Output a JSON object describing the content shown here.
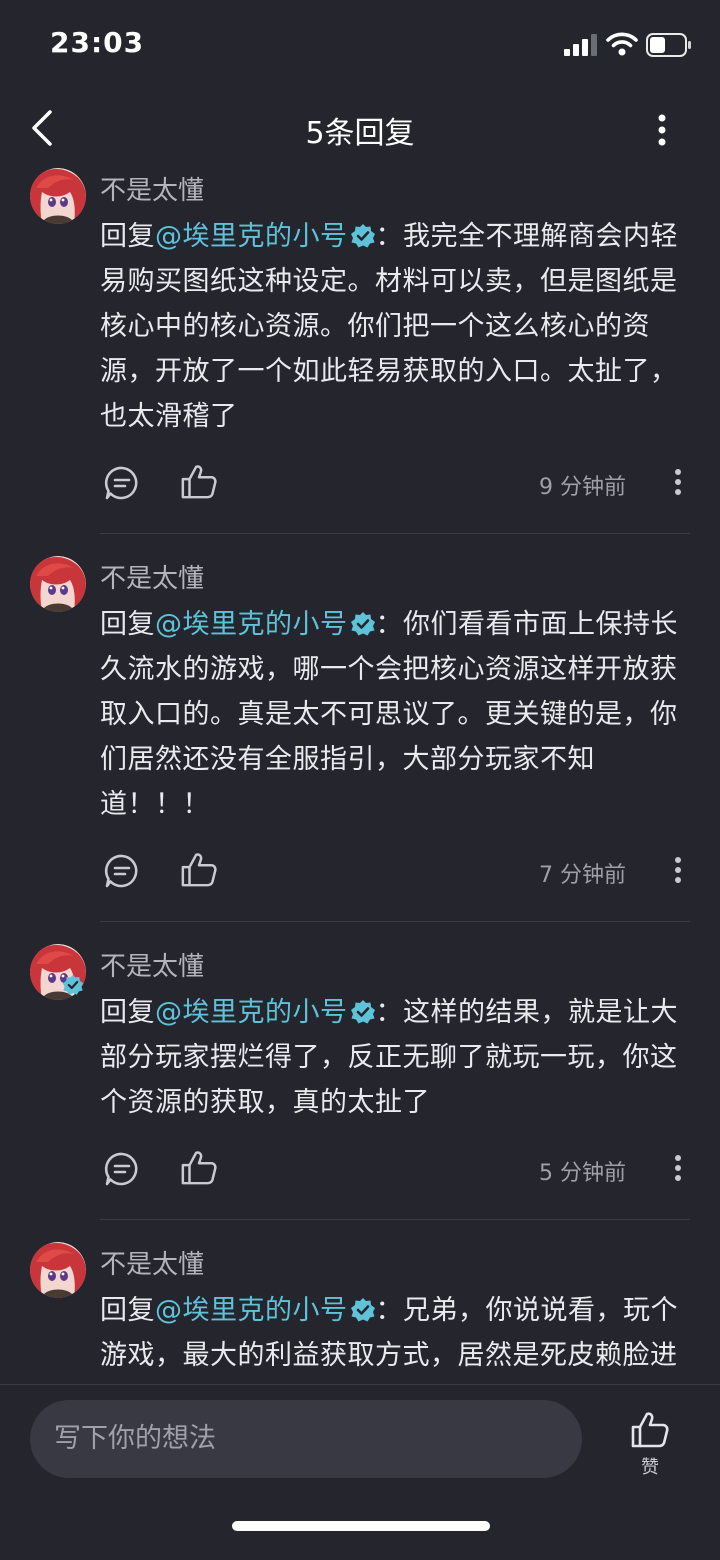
{
  "status_bar": {
    "time": "23:03"
  },
  "header": {
    "title": "5条回复"
  },
  "comments": [
    {
      "author": "不是太懂",
      "reply_prefix": "回复",
      "mention": "@埃里克的小号",
      "text": "：我完全不理解商会内轻易购买图纸这种设定。材料可以卖，但是图纸是核心中的核心资源。你们把一个这么核心的资源，开放了一个如此轻易获取的入口。太扯了，也太滑稽了",
      "time": "9 分钟前"
    },
    {
      "author": "不是太懂",
      "reply_prefix": "回复",
      "mention": "@埃里克的小号",
      "text": "：你们看看市面上保持长久流水的游戏，哪一个会把核心资源这样开放获取入口的。真是太不可思议了。更关键的是，你们居然还没有全服指引，大部分玩家不知道！！！",
      "time": "7 分钟前"
    },
    {
      "author": "不是太懂",
      "reply_prefix": "回复",
      "mention": "@埃里克的小号",
      "text": "：这样的结果，就是让大部分玩家摆烂得了，反正无聊了就玩一玩，你这个资源的获取，真的太扯了",
      "time": "5 分钟前"
    },
    {
      "author": "不是太懂",
      "reply_prefix": "回复",
      "mention": "@埃里克的小号",
      "text": "：兄弟，你说说看，玩个游戏，最大的利益获取方式，居然是死皮赖脸进个大商会，我都觉得可笑。wow那么重视工会机",
      "time": ""
    }
  ],
  "composer": {
    "placeholder": "写下你的想法",
    "like_label": "赞"
  },
  "colors": {
    "background": "#24252d",
    "mention": "#5ec2d9",
    "verified": "#5ec2d9"
  }
}
